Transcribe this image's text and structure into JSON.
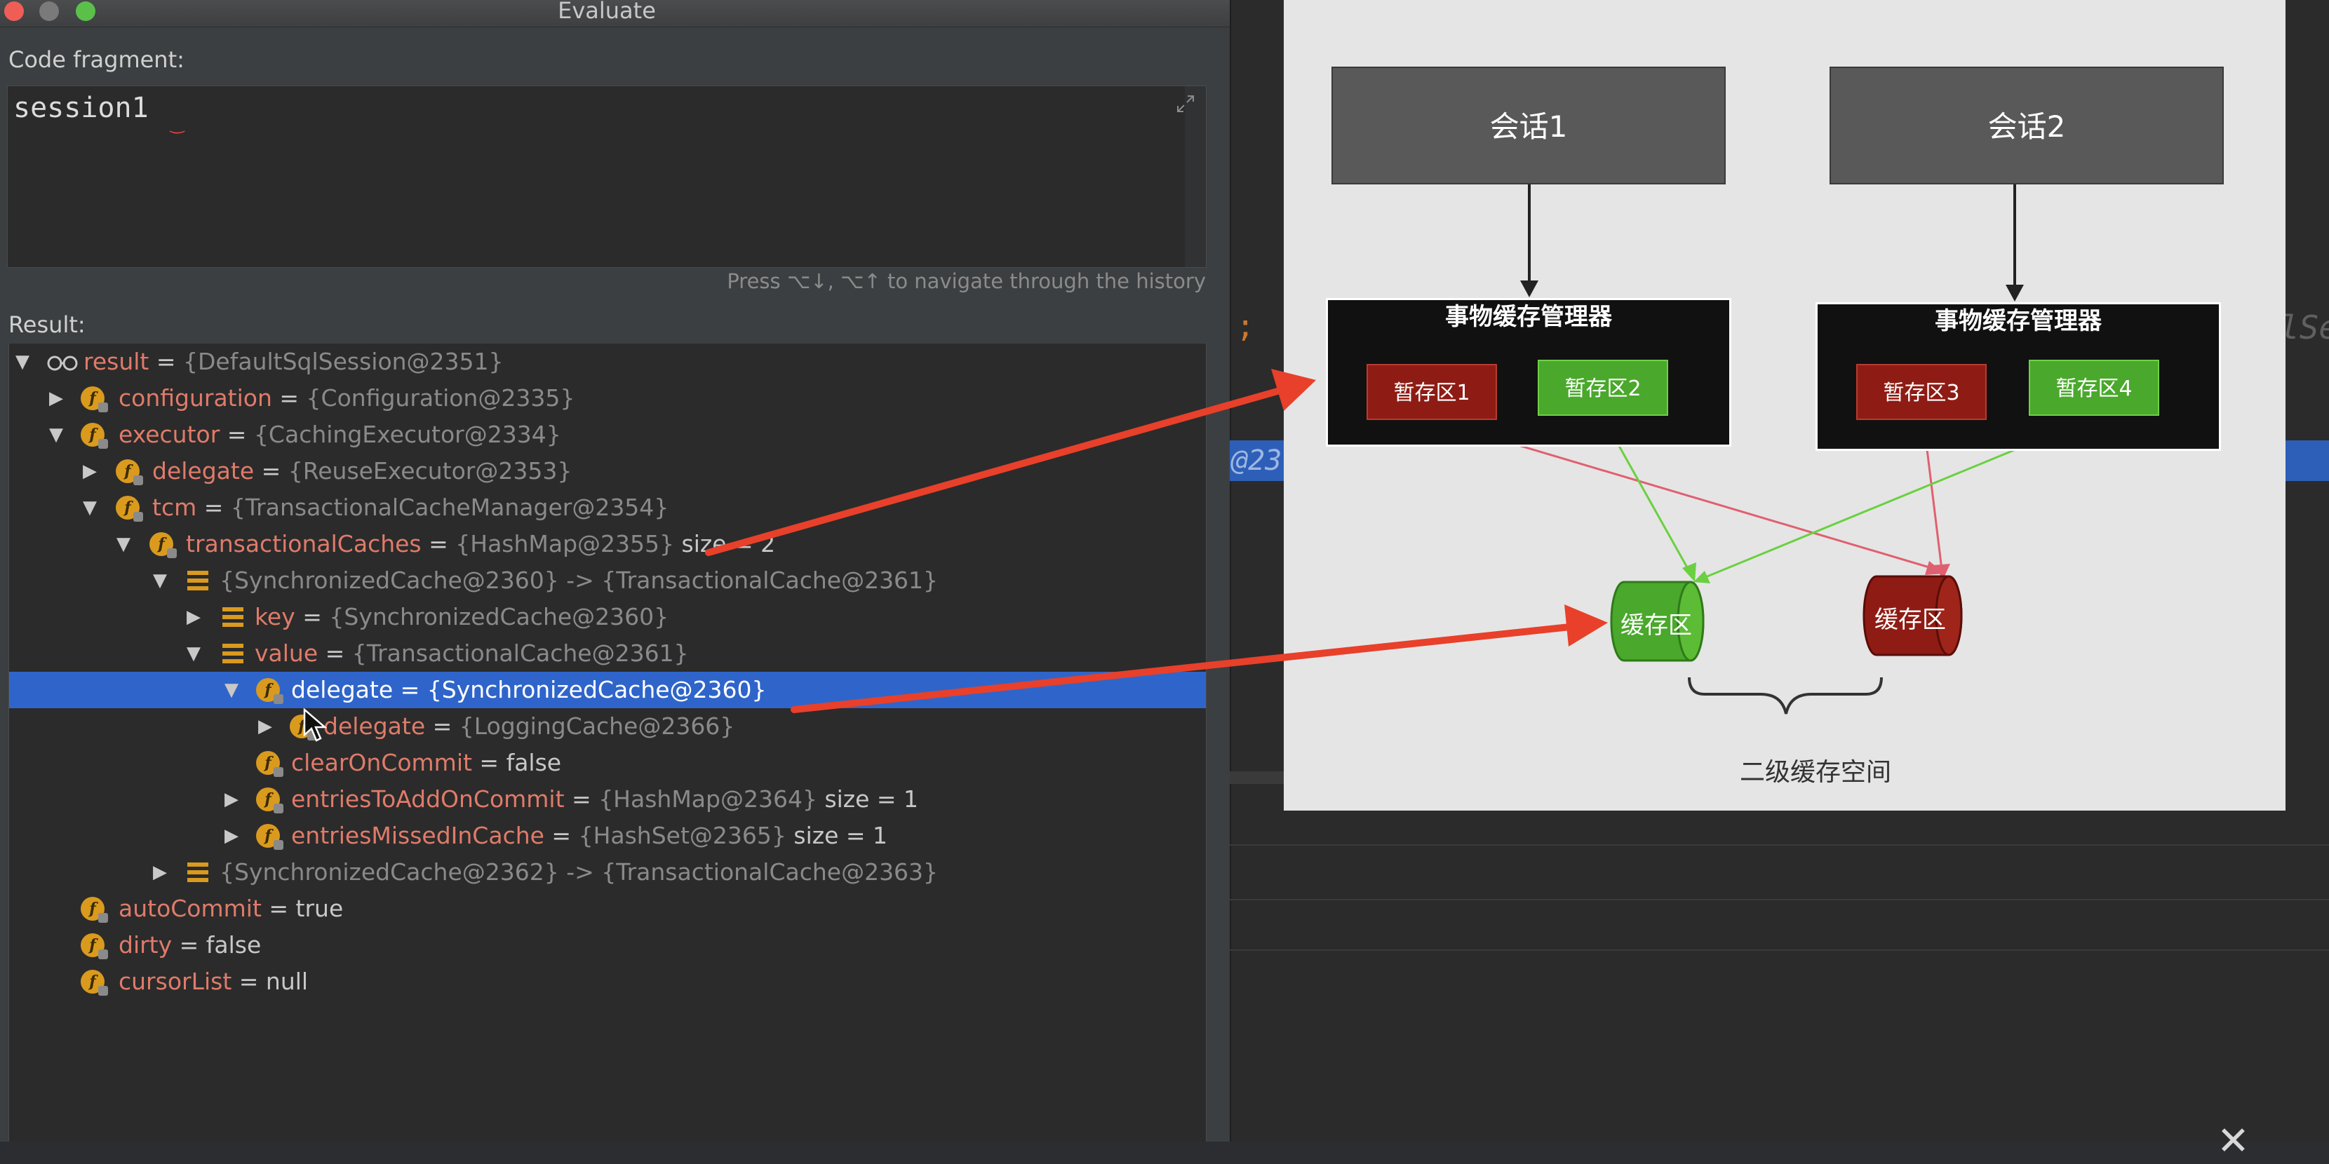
{
  "window": {
    "title": "Evaluate"
  },
  "code": {
    "label": "Code fragment:",
    "value": "session1",
    "history_hint": "Press ⌥↓, ⌥↑ to navigate through the history"
  },
  "result": {
    "label": "Result:",
    "rows": [
      {
        "name": "result",
        "eq": " = ",
        "value": "{DefaultSqlSession@2351}",
        "extra": ""
      },
      {
        "name": "configuration",
        "eq": " = ",
        "value": "{Configuration@2335}",
        "extra": ""
      },
      {
        "name": "executor",
        "eq": " = ",
        "value": "{CachingExecutor@2334}",
        "extra": ""
      },
      {
        "name": "delegate",
        "eq": " = ",
        "value": "{ReuseExecutor@2353}",
        "extra": ""
      },
      {
        "name": "tcm",
        "eq": " = ",
        "value": "{TransactionalCacheManager@2354}",
        "extra": ""
      },
      {
        "name": "transactionalCaches",
        "eq": " = ",
        "value": "{HashMap@2355}",
        "extra": " size = 2"
      },
      {
        "name": "",
        "eq": "",
        "value": "{SynchronizedCache@2360}  -> {TransactionalCache@2361}",
        "extra": ""
      },
      {
        "name": "key",
        "eq": " = ",
        "value": "{SynchronizedCache@2360}",
        "extra": ""
      },
      {
        "name": "value",
        "eq": " = ",
        "value": "{TransactionalCache@2361}",
        "extra": ""
      },
      {
        "name": "delegate",
        "eq": " = ",
        "value": "{SynchronizedCache@2360}",
        "extra": ""
      },
      {
        "name": "delegate",
        "eq": " = ",
        "value": "{LoggingCache@2366}",
        "extra": ""
      },
      {
        "name": "clearOnCommit",
        "eq": " = ",
        "value": "false",
        "extra": ""
      },
      {
        "name": "entriesToAddOnCommit",
        "eq": " = ",
        "value": "{HashMap@2364}",
        "extra": "  size = 1"
      },
      {
        "name": "entriesMissedInCache",
        "eq": " = ",
        "value": "{HashSet@2365}",
        "extra": "  size = 1"
      },
      {
        "name": "",
        "eq": "",
        "value": "{SynchronizedCache@2362}  -> {TransactionalCache@2363}",
        "extra": ""
      },
      {
        "name": "autoCommit",
        "eq": " = ",
        "value": "true",
        "extra": ""
      },
      {
        "name": "dirty",
        "eq": " = ",
        "value": "false",
        "extra": ""
      },
      {
        "name": "cursorList",
        "eq": " = ",
        "value": "null",
        "extra": ""
      }
    ]
  },
  "background_editor": {
    "semicolon": ";",
    "selected_fragment": "@23",
    "right_fragment": "lSe"
  },
  "diagram": {
    "session1": "会话1",
    "session2": "会话2",
    "manager1_title": "事物缓存管理器",
    "manager2_title": "事物缓存管理器",
    "staging1": "暂存区1",
    "staging2": "暂存区2",
    "staging3": "暂存区3",
    "staging4": "暂存区4",
    "cache_green": "缓存区",
    "cache_red": "缓存区",
    "space_label": "二级缓存空间"
  },
  "colors": {
    "selection": "#2f65ca",
    "field_name": "#e07b6a",
    "field_icon": "#d99a1e",
    "annotation_arrow": "#e8402a",
    "cache_green": "#4aa82c",
    "cache_red": "#8e1c14"
  }
}
